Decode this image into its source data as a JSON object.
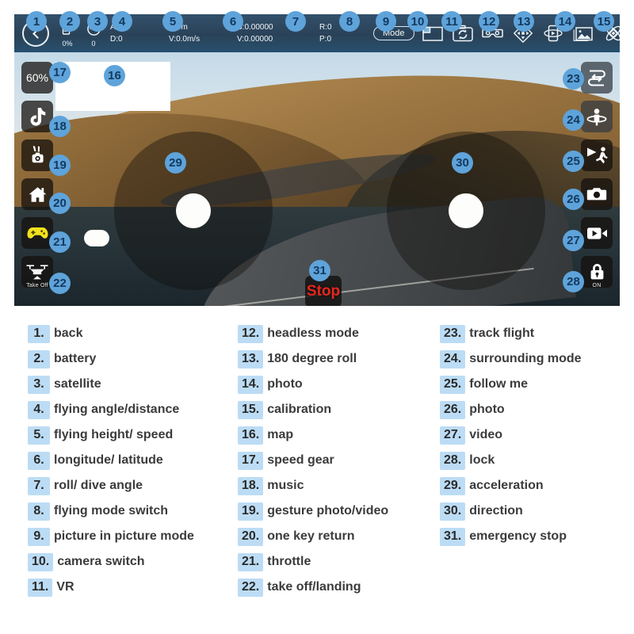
{
  "app": {
    "back_button": "back",
    "status": {
      "battery": {
        "icon": "battery-icon",
        "value": "0%"
      },
      "satellite": {
        "icon": "satellite-icon",
        "value": "0"
      },
      "angle_distance": {
        "line1": "A:0°",
        "line2": "D:0"
      },
      "height_speed": {
        "line1": "H:0m",
        "line2": "V:0.0m/s"
      },
      "coordinates": {
        "line1": "S:0.00000",
        "line2": "V:0.00000"
      },
      "roll_dive": {
        "line1": "R:0",
        "line2": "P:0"
      }
    },
    "toolbar": {
      "mode_label": "Mode",
      "icons": [
        {
          "name": "picture-in-picture-icon",
          "label": "picture in picture mode"
        },
        {
          "name": "camera-switch-icon",
          "label": "camera switch"
        },
        {
          "name": "vr-goggles-icon",
          "label": "VR"
        },
        {
          "name": "headless-mode-icon",
          "label": "headless mode"
        },
        {
          "name": "180-degree-roll-icon",
          "label": "180 degree roll"
        },
        {
          "name": "photo-icon",
          "label": "photo"
        },
        {
          "name": "calibration-icon",
          "label": "calibration"
        }
      ]
    },
    "left_rail": [
      {
        "name": "speed-gear-button",
        "label": "60%",
        "caption": ""
      },
      {
        "name": "music-button",
        "label": "",
        "caption": ""
      },
      {
        "name": "gesture-photo-button",
        "label": "",
        "caption": ""
      },
      {
        "name": "one-key-return-button",
        "label": "",
        "caption": ""
      },
      {
        "name": "throttle-button",
        "label": "",
        "caption": ""
      },
      {
        "name": "take-off-button",
        "label": "",
        "caption": "Take Off"
      }
    ],
    "right_rail": [
      {
        "name": "track-flight-button",
        "caption": ""
      },
      {
        "name": "surrounding-mode-button",
        "caption": ""
      },
      {
        "name": "follow-me-button",
        "caption": ""
      },
      {
        "name": "photo-capture-button",
        "caption": ""
      },
      {
        "name": "video-record-button",
        "caption": ""
      },
      {
        "name": "lock-button",
        "caption": "ON"
      }
    ],
    "emergency_stop_label": "Stop",
    "map_panel": "map",
    "joystick_left": "acceleration",
    "joystick_right": "direction"
  },
  "badges": {
    "accent_color": "#5ea3da",
    "numbers": [
      "1",
      "2",
      "3",
      "4",
      "5",
      "6",
      "7",
      "8",
      "9",
      "10",
      "11",
      "12",
      "13",
      "14",
      "15",
      "16",
      "17",
      "18",
      "19",
      "20",
      "21",
      "22",
      "23",
      "24",
      "25",
      "26",
      "27",
      "28",
      "29",
      "30",
      "31"
    ]
  },
  "legend": {
    "number_bg": "#bcdcf5",
    "columns": [
      [
        {
          "num": "1.",
          "text": "back"
        },
        {
          "num": "2.",
          "text": "battery"
        },
        {
          "num": "3.",
          "text": "satellite"
        },
        {
          "num": "4.",
          "text": "flying angle/distance"
        },
        {
          "num": "5.",
          "text": "flying height/ speed"
        },
        {
          "num": "6.",
          "text": "longitude/ latitude"
        },
        {
          "num": "7.",
          "text": "roll/ dive angle"
        },
        {
          "num": "8.",
          "text": "flying mode switch"
        },
        {
          "num": "9.",
          "text": "picture in picture mode"
        },
        {
          "num": "10.",
          "text": "camera switch"
        },
        {
          "num": "11.",
          "text": "VR"
        }
      ],
      [
        {
          "num": "12.",
          "text": "headless mode"
        },
        {
          "num": "13.",
          "text": "180 degree roll"
        },
        {
          "num": "14.",
          "text": "photo"
        },
        {
          "num": "15.",
          "text": "calibration"
        },
        {
          "num": "16.",
          "text": "map"
        },
        {
          "num": "17.",
          "text": "speed gear"
        },
        {
          "num": "18.",
          "text": "music"
        },
        {
          "num": "19.",
          "text": "gesture photo/video"
        },
        {
          "num": "20.",
          "text": "one key return"
        },
        {
          "num": "21.",
          "text": "throttle"
        },
        {
          "num": "22.",
          "text": "take off/landing"
        }
      ],
      [
        {
          "num": "23.",
          "text": "track flight"
        },
        {
          "num": "24.",
          "text": "surrounding mode"
        },
        {
          "num": "25.",
          "text": "follow me"
        },
        {
          "num": "26.",
          "text": "photo"
        },
        {
          "num": "27.",
          "text": "video"
        },
        {
          "num": "28.",
          "text": "lock"
        },
        {
          "num": "29.",
          "text": "acceleration"
        },
        {
          "num": "30.",
          "text": "direction"
        },
        {
          "num": "31.",
          "text": "emergency stop"
        }
      ]
    ]
  }
}
